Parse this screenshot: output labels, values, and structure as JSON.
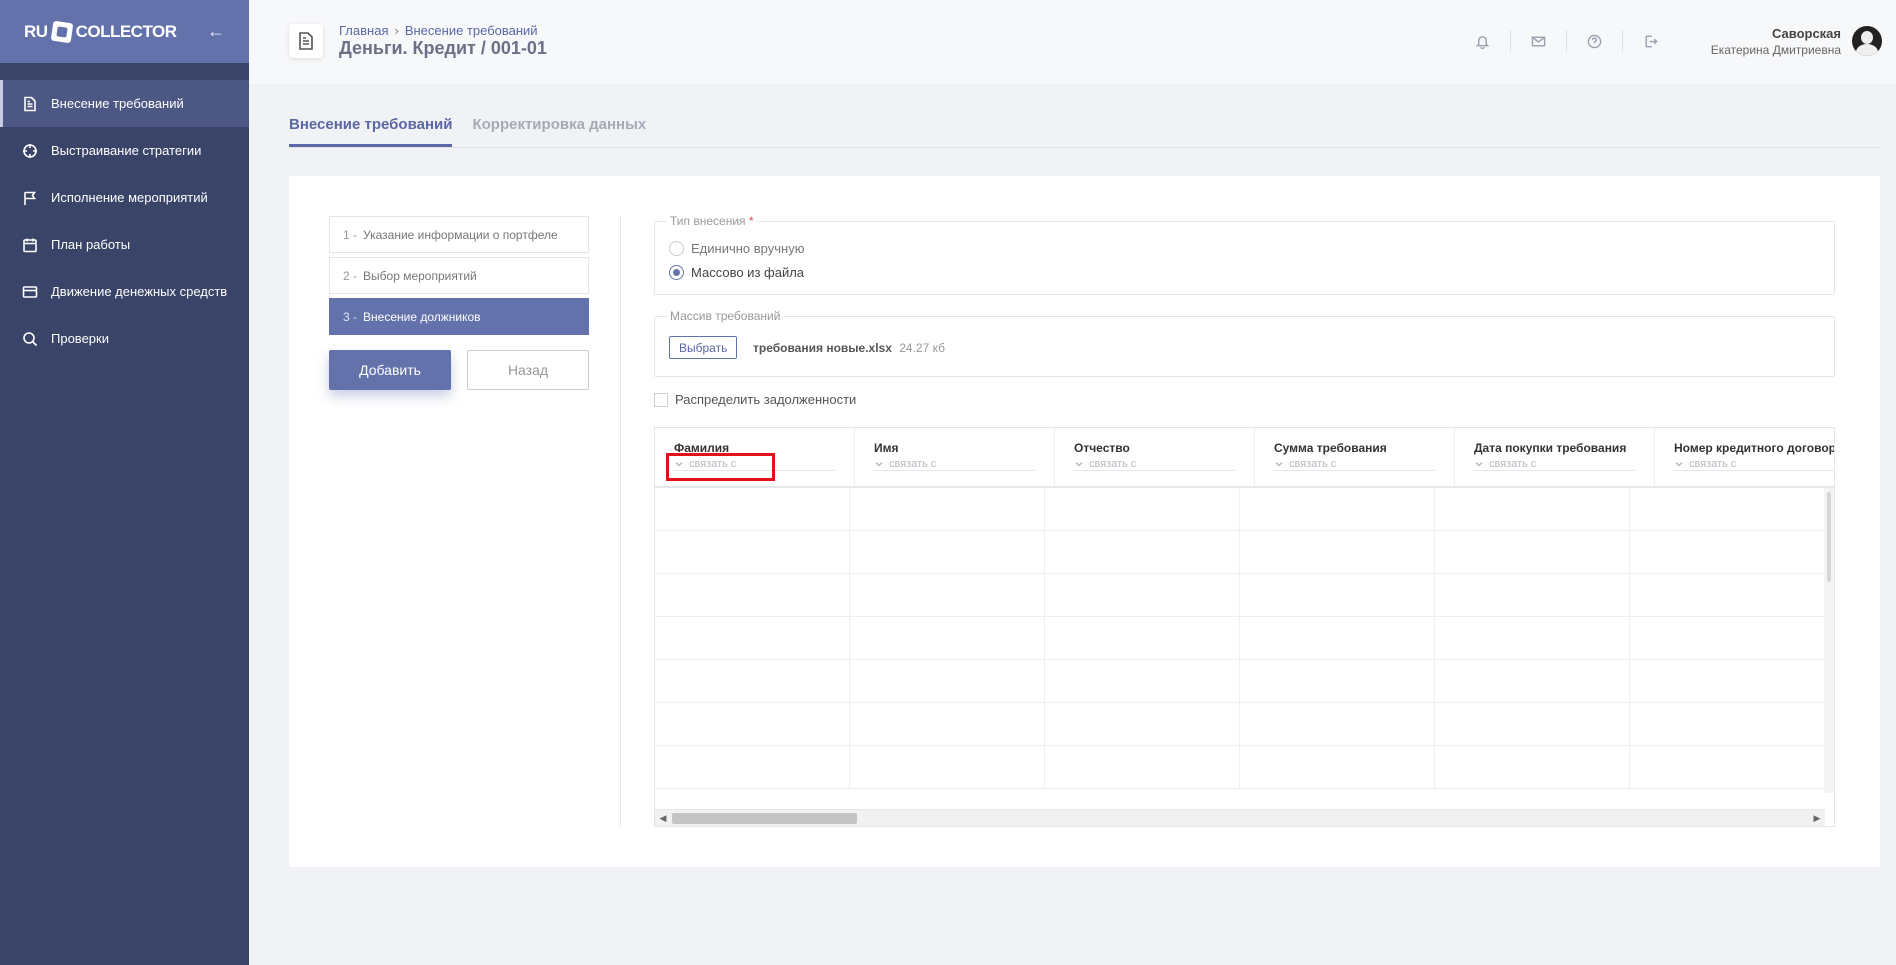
{
  "sidebar": {
    "logo_left": "RU",
    "logo_right": "COLLECTOR",
    "items": [
      {
        "label": "Внесение требований",
        "icon": "document-icon",
        "active": true
      },
      {
        "label": "Выстраивание стратегии",
        "icon": "crosshair-icon",
        "active": false
      },
      {
        "label": "Исполнение мероприятий",
        "icon": "flag-icon",
        "active": false
      },
      {
        "label": "План работы",
        "icon": "calendar-icon",
        "active": false
      },
      {
        "label": "Движение денежных средств",
        "icon": "card-icon",
        "active": false
      },
      {
        "label": "Проверки",
        "icon": "search-icon",
        "active": false
      }
    ]
  },
  "header": {
    "breadcrumb_home": "Главная",
    "breadcrumb_sep": "›",
    "breadcrumb_current": "Внесение требований",
    "title": "Деньги. Кредит / 001-01",
    "icons": [
      "bell-icon",
      "mail-icon",
      "help-icon",
      "logout-icon"
    ],
    "user_last_name": "Саворская",
    "user_first_name": "Екатерина Дмитриевна"
  },
  "tabs": [
    {
      "label": "Внесение требований",
      "active": true
    },
    {
      "label": "Корректировка данных",
      "active": false
    }
  ],
  "steps": [
    {
      "num": "1 -",
      "label": "Указание информации о портфеле",
      "active": false
    },
    {
      "num": "2 -",
      "label": "Выбор мероприятий",
      "active": false
    },
    {
      "num": "3 -",
      "label": "Внесение должников",
      "active": true
    }
  ],
  "buttons": {
    "add": "Добавить",
    "back": "Назад"
  },
  "entry_type": {
    "legend": "Тип внесения",
    "required_mark": "*",
    "options": [
      {
        "label": "Единично вручную",
        "selected": false
      },
      {
        "label": "Массово из файла",
        "selected": true
      }
    ]
  },
  "file_section": {
    "legend": "Массив требований",
    "choose_label": "Выбрать",
    "file_name": "требования новые.xlsx",
    "file_size": "24.27 кб"
  },
  "distribute_checkbox": {
    "label": "Распределить задолженности",
    "checked": false
  },
  "table": {
    "bind_placeholder": "связать с",
    "columns": [
      "Фамилия",
      "Имя",
      "Отчество",
      "Сумма требования",
      "Дата покупки требования",
      "Номер кредитного договора"
    ],
    "row_count": 7
  },
  "colors": {
    "accent": "#6472ac",
    "sidebar_bg": "#3a4468",
    "highlight": "#e3111b"
  }
}
